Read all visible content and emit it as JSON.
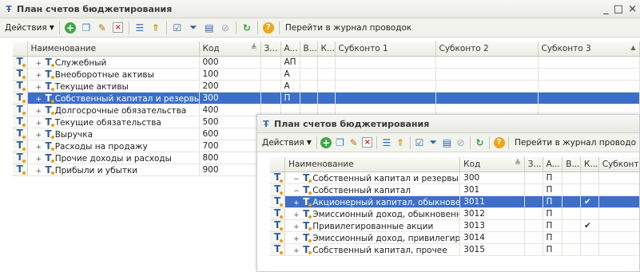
{
  "window1": {
    "title": "План счетов бюджетирования",
    "toolbar": {
      "actions_label": "Действия",
      "journal_link": "Перейти в журнал проводок"
    },
    "columns": [
      "",
      "Наименование",
      "Код",
      "З...",
      "А...",
      "В...",
      "К...",
      "Субконто 1",
      "Субконто 2",
      "Субконто 3"
    ],
    "rows": [
      {
        "name": "Служебный",
        "code": "000",
        "a": "АП",
        "k": ""
      },
      {
        "name": "Внеоборотные активы",
        "code": "100",
        "a": "А",
        "k": ""
      },
      {
        "name": "Текущие активы",
        "code": "200",
        "a": "А",
        "k": ""
      },
      {
        "name": "Собственный капитал и резервы",
        "code": "300",
        "a": "П",
        "k": "",
        "selected": true
      },
      {
        "name": "Долгосрочные обязательства",
        "code": "400",
        "a": "",
        "k": ""
      },
      {
        "name": "Текущие обязательства",
        "code": "500",
        "a": "",
        "k": ""
      },
      {
        "name": "Выручка",
        "code": "600",
        "a": "",
        "k": ""
      },
      {
        "name": "Расходы на продажу",
        "code": "700",
        "a": "",
        "k": ""
      },
      {
        "name": "Прочие доходы и расходы",
        "code": "800",
        "a": "",
        "k": ""
      },
      {
        "name": "Прибыли и убытки",
        "code": "900",
        "a": "",
        "k": ""
      }
    ]
  },
  "window2": {
    "title": "План счетов бюджетирования",
    "toolbar": {
      "actions_label": "Действия",
      "journal_link": "Перейти в журнал проводо"
    },
    "columns": [
      "",
      "Наименование",
      "Код",
      "З...",
      "А...",
      "В...",
      "К...",
      "Субконто"
    ],
    "rows": [
      {
        "name": "Собственный капитал и резервы",
        "code": "300",
        "a": "П",
        "k": "",
        "expand": "−"
      },
      {
        "name": "Собственный капитал",
        "code": "301",
        "a": "П",
        "k": "",
        "expand": "−"
      },
      {
        "name": "Акционерный капитал, обыкновен...",
        "code": "3011",
        "a": "П",
        "k": "✔",
        "expand": "+",
        "selected": true
      },
      {
        "name": "Эмиссионный доход, обыкновенны...",
        "code": "3012",
        "a": "П",
        "k": "",
        "expand": "+"
      },
      {
        "name": "Привилегированные акции",
        "code": "3013",
        "a": "П",
        "k": "✔",
        "expand": "+"
      },
      {
        "name": "Эмиссионный доход, привилегиров...",
        "code": "3014",
        "a": "П",
        "k": "",
        "expand": "+"
      },
      {
        "name": "Собственный капитал, прочее",
        "code": "3015",
        "a": "П",
        "k": "",
        "expand": "+"
      }
    ]
  },
  "glyphs": {
    "row_icon": "T",
    "tree_icon": "T",
    "collapsed": "+",
    "minimize": "_",
    "maximize": "□",
    "close": "×"
  }
}
